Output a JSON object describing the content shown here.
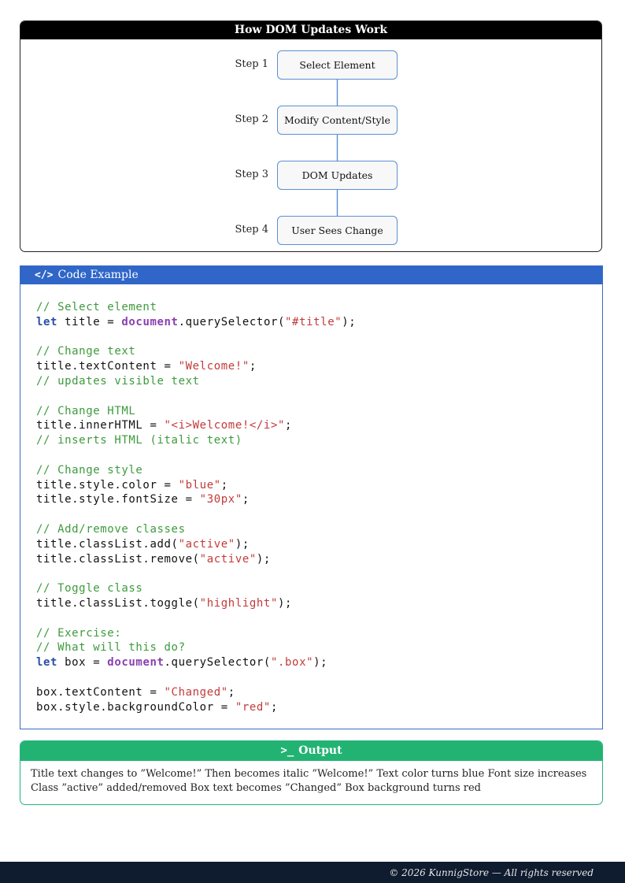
{
  "flow": {
    "title": "How DOM Updates Work",
    "steps": [
      {
        "label": "Step 1",
        "text": "Select Element"
      },
      {
        "label": "Step 2",
        "text": "Modify Content/Style"
      },
      {
        "label": "Step 3",
        "text": "DOM Updates"
      },
      {
        "label": "Step 4",
        "text": "User Sees Change"
      }
    ]
  },
  "code": {
    "icon": "</>",
    "title": "Code Example",
    "lines": [
      [
        {
          "t": "comment",
          "v": "// Select element"
        }
      ],
      [
        {
          "t": "kw",
          "v": "let"
        },
        {
          "t": "plain",
          "v": " title = "
        },
        {
          "t": "doc",
          "v": "document"
        },
        {
          "t": "plain",
          "v": ".querySelector("
        },
        {
          "t": "str",
          "v": "\"#title\""
        },
        {
          "t": "plain",
          "v": ");"
        }
      ],
      [],
      [
        {
          "t": "comment",
          "v": "// Change text"
        }
      ],
      [
        {
          "t": "plain",
          "v": "title.textContent = "
        },
        {
          "t": "str",
          "v": "\"Welcome!\""
        },
        {
          "t": "plain",
          "v": ";"
        }
      ],
      [
        {
          "t": "comment",
          "v": "// updates visible text"
        }
      ],
      [],
      [
        {
          "t": "comment",
          "v": "// Change HTML"
        }
      ],
      [
        {
          "t": "plain",
          "v": "title.innerHTML = "
        },
        {
          "t": "str",
          "v": "\"<i>Welcome!</i>\""
        },
        {
          "t": "plain",
          "v": ";"
        }
      ],
      [
        {
          "t": "comment",
          "v": "// inserts HTML (italic text)"
        }
      ],
      [],
      [
        {
          "t": "comment",
          "v": "// Change style"
        }
      ],
      [
        {
          "t": "plain",
          "v": "title.style.color = "
        },
        {
          "t": "str",
          "v": "\"blue\""
        },
        {
          "t": "plain",
          "v": ";"
        }
      ],
      [
        {
          "t": "plain",
          "v": "title.style.fontSize = "
        },
        {
          "t": "str",
          "v": "\"30px\""
        },
        {
          "t": "plain",
          "v": ";"
        }
      ],
      [],
      [
        {
          "t": "comment",
          "v": "// Add/remove classes"
        }
      ],
      [
        {
          "t": "plain",
          "v": "title.classList.add("
        },
        {
          "t": "str",
          "v": "\"active\""
        },
        {
          "t": "plain",
          "v": ");"
        }
      ],
      [
        {
          "t": "plain",
          "v": "title.classList.remove("
        },
        {
          "t": "str",
          "v": "\"active\""
        },
        {
          "t": "plain",
          "v": ");"
        }
      ],
      [],
      [
        {
          "t": "comment",
          "v": "// Toggle class"
        }
      ],
      [
        {
          "t": "plain",
          "v": "title.classList.toggle("
        },
        {
          "t": "str",
          "v": "\"highlight\""
        },
        {
          "t": "plain",
          "v": ");"
        }
      ],
      [],
      [
        {
          "t": "comment",
          "v": "// Exercise:"
        }
      ],
      [
        {
          "t": "comment",
          "v": "// What will this do?"
        }
      ],
      [
        {
          "t": "kw",
          "v": "let"
        },
        {
          "t": "plain",
          "v": " box = "
        },
        {
          "t": "doc",
          "v": "document"
        },
        {
          "t": "plain",
          "v": ".querySelector("
        },
        {
          "t": "str",
          "v": "\".box\""
        },
        {
          "t": "plain",
          "v": ");"
        }
      ],
      [],
      [
        {
          "t": "plain",
          "v": "box.textContent = "
        },
        {
          "t": "str",
          "v": "\"Changed\""
        },
        {
          "t": "plain",
          "v": ";"
        }
      ],
      [
        {
          "t": "plain",
          "v": "box.style.backgroundColor = "
        },
        {
          "t": "str",
          "v": "\"red\""
        },
        {
          "t": "plain",
          "v": ";"
        }
      ]
    ]
  },
  "output": {
    "icon": ">_",
    "title": "Output",
    "text": "Title text changes to ”Welcome!” Then becomes italic ”Welcome!” Text color turns blue Font size increases Class ”active” added/removed Box text becomes ”Changed” Box background turns red"
  },
  "footer": {
    "text": "© 2026 KunnigStore — All rights reserved"
  },
  "colors": {
    "flow_header": "#000000",
    "node_border": "#5b8fd4",
    "code_header": "#2f66c8",
    "output_header": "#22b372",
    "footer_bg": "#0f1b2e",
    "comment": "#3d9a3d",
    "keyword": "#2b4fa8",
    "document": "#8a3fb0",
    "string": "#c23a3a"
  }
}
